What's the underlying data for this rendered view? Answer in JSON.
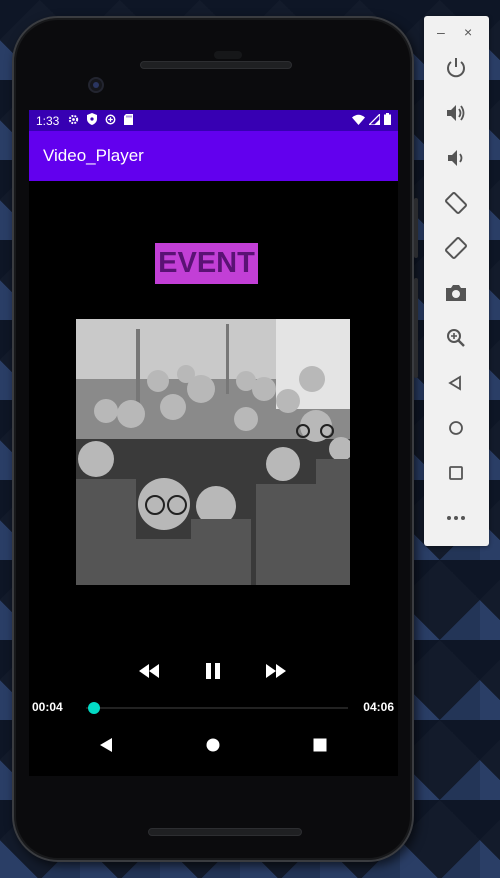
{
  "status_bar": {
    "time": "1:33",
    "icons": [
      "gear-icon",
      "shield-icon",
      "data-saver-icon",
      "sd-card-icon"
    ],
    "right_icons": [
      "wifi-icon",
      "signal-icon",
      "battery-icon"
    ]
  },
  "app_bar": {
    "title": "Video_Player"
  },
  "video": {
    "label": "EVENT",
    "label_bg": "#c23fd6",
    "thumbnail_desc": "group-photo"
  },
  "player": {
    "current_time": "00:04",
    "duration": "04:06",
    "progress_fraction": 0.016,
    "buttons": [
      "rewind-icon",
      "pause-icon",
      "fast-forward-icon"
    ],
    "accent": "#03dac5"
  },
  "nav": {
    "buttons": [
      "back-icon",
      "home-icon",
      "recents-icon"
    ]
  },
  "emulator_toolbar": {
    "window_controls": [
      "minimize-icon",
      "close-icon"
    ],
    "buttons": [
      "power-icon",
      "volume-up-icon",
      "volume-down-icon",
      "rotate-left-icon",
      "rotate-right-icon",
      "screenshot-icon",
      "zoom-icon",
      "back-icon",
      "home-icon",
      "overview-icon",
      "more-icon"
    ]
  },
  "colors": {
    "status_bar": "#3700b3",
    "app_bar": "#6200ee"
  }
}
